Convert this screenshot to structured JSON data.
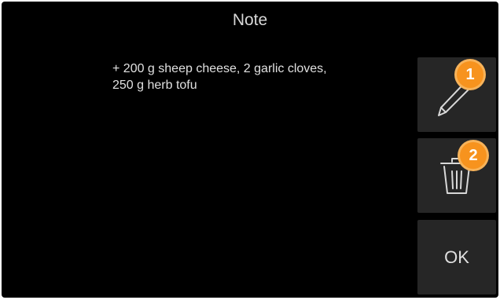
{
  "dialog": {
    "title": "Note",
    "note_text": "+ 200 g sheep cheese, 2 garlic cloves,\n250 g herb tofu"
  },
  "buttons": {
    "edit_icon": "pencil-icon",
    "delete_icon": "trash-icon",
    "ok_label": "OK"
  },
  "annotations": {
    "badge_1": "1",
    "badge_2": "2"
  },
  "colors": {
    "background": "#000000",
    "button": "#262626",
    "text": "#e0e0e0",
    "badge": "#f7931e"
  }
}
